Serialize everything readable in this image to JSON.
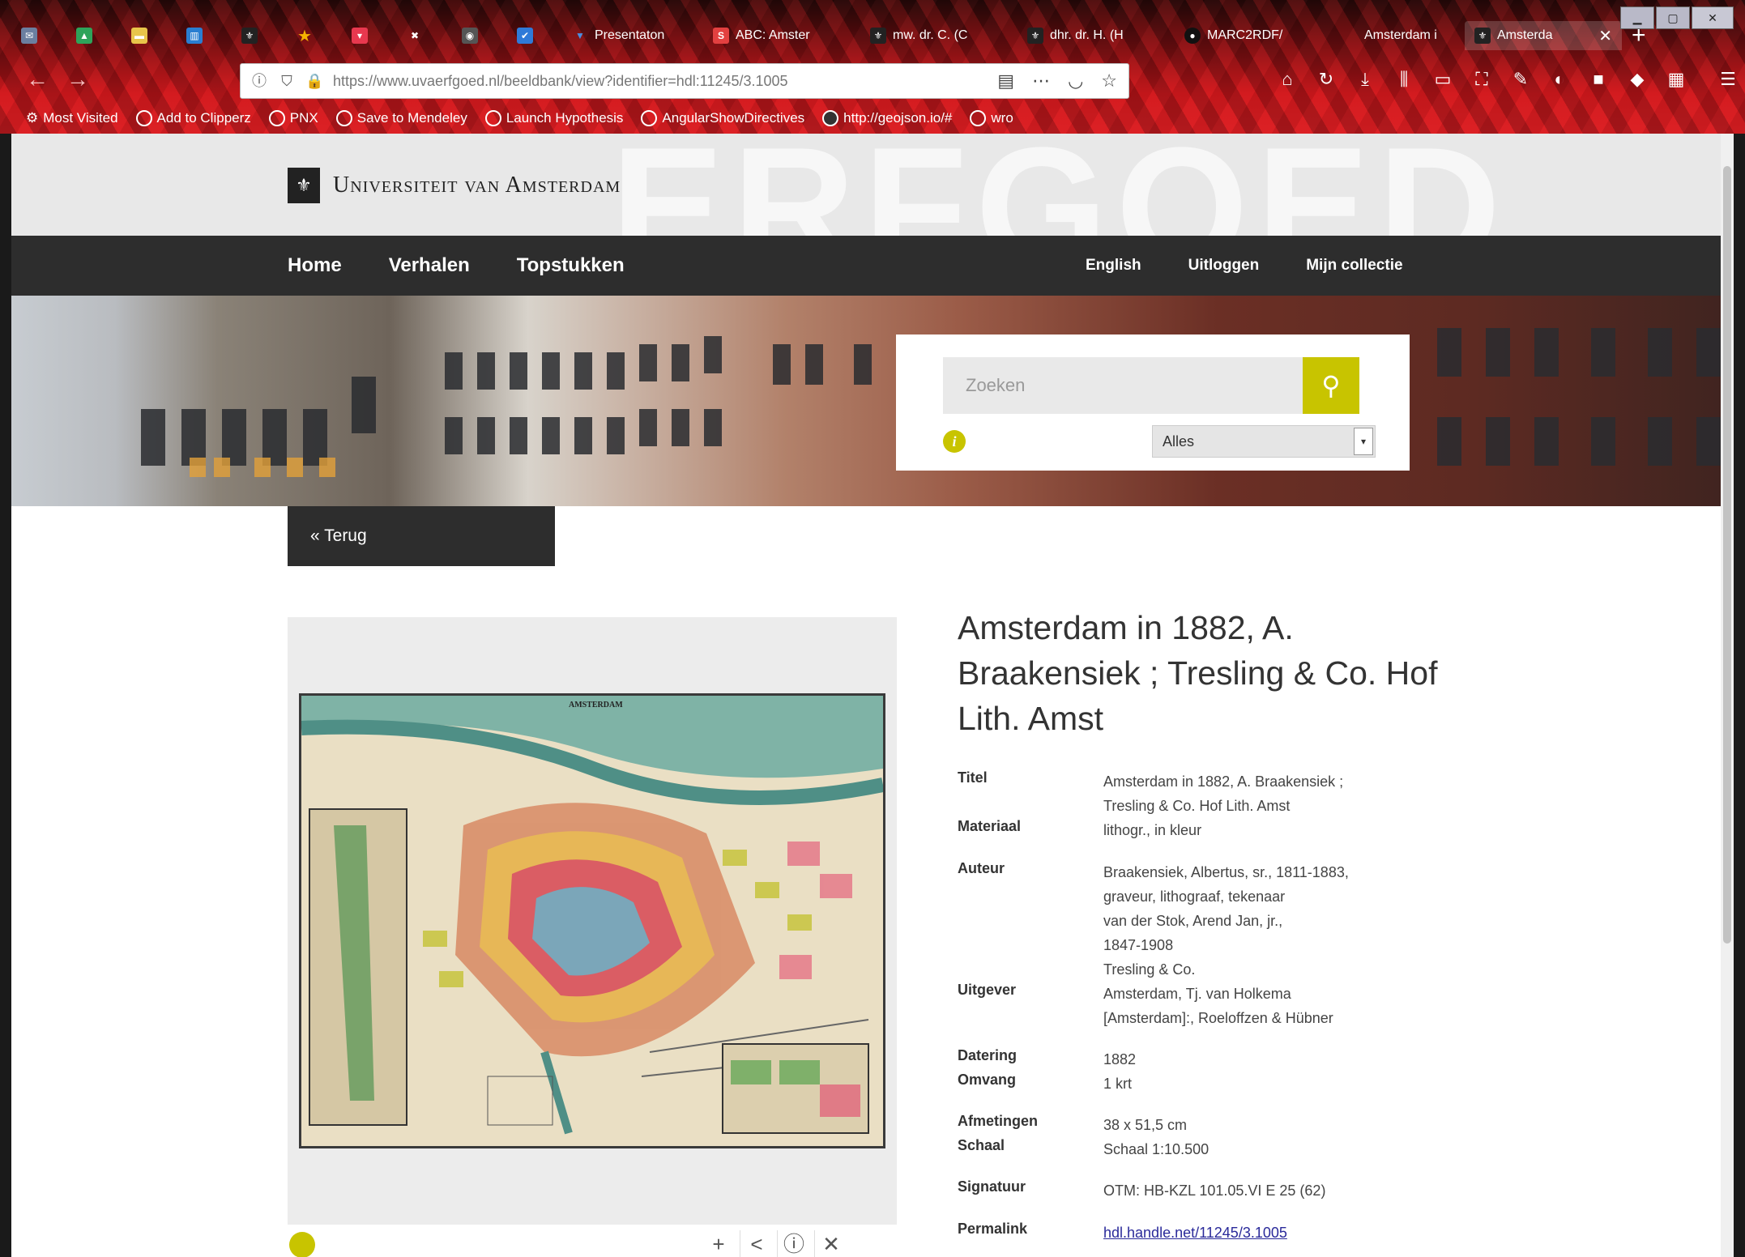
{
  "browser": {
    "tabs": [
      {
        "label": "",
        "icon": "mail-icon"
      },
      {
        "label": "",
        "icon": "drive-icon"
      },
      {
        "label": "",
        "icon": "folder-icon"
      },
      {
        "label": "",
        "icon": "trello-icon"
      },
      {
        "label": "",
        "icon": "uva-icon"
      },
      {
        "label": "",
        "icon": "star-icon"
      },
      {
        "label": "",
        "icon": "pocket-icon"
      },
      {
        "label": "",
        "icon": "pin-icon"
      },
      {
        "label": "",
        "icon": "app-icon"
      },
      {
        "label": "",
        "icon": "check-icon"
      },
      {
        "label": "Presentaton",
        "icon": "triangle-icon"
      },
      {
        "label": "ABC: Amster",
        "icon": "s-icon"
      },
      {
        "label": "mw. dr. C. (C",
        "icon": "uva-icon"
      },
      {
        "label": "dhr. dr. H. (H",
        "icon": "uva-icon"
      },
      {
        "label": "MARC2RDF/",
        "icon": "github-icon"
      },
      {
        "label": "Amsterdam i",
        "icon": "blank-icon"
      },
      {
        "label": "Amsterda",
        "icon": "uva-icon"
      }
    ],
    "url": "https://www.uvaerfgoed.nl/beeldbank/view?identifier=hdl:11245/3.1005",
    "bookmarks": [
      "Most Visited",
      "Add to Clipperz",
      "PNX",
      "Save to Mendeley",
      "Launch Hypothesis",
      "AngularShowDirectives",
      "http://geojson.io/#",
      "wro"
    ]
  },
  "site": {
    "header_watermark": "ERFGOED",
    "logo_text": "Universiteit van Amsterdam",
    "nav_left": [
      "Home",
      "Verhalen",
      "Topstukken"
    ],
    "nav_right": [
      "English",
      "Uitloggen",
      "Mijn collectie"
    ],
    "search_placeholder": "Zoeken",
    "search_scope": "Alles",
    "back_label": "« Terug"
  },
  "record": {
    "title": "Amsterdam in 1882, A. Braakensiek ; Tresling & Co. Hof Lith. Amst",
    "map_caption": "AMSTERDAM",
    "fields": [
      {
        "key": "Titel",
        "lines": [
          "Amsterdam in 1882, A. Braakensiek ;",
          "Tresling & Co. Hof Lith. Amst"
        ]
      },
      {
        "key": "Materiaal",
        "lines": [
          "lithogr., in kleur"
        ]
      },
      {
        "key": "Auteur",
        "lines": [
          "Braakensiek, Albertus, sr., 1811-1883,",
          "graveur, lithograaf, tekenaar",
          "van der Stok, Arend Jan, jr.,",
          "1847-1908",
          "Tresling & Co."
        ]
      },
      {
        "key": "Uitgever",
        "lines": [
          "Amsterdam, Tj. van Holkema",
          "[Amsterdam]:, Roeloffzen & Hübner"
        ]
      },
      {
        "key": "Datering",
        "lines": [
          "1882"
        ]
      },
      {
        "key": "Omvang",
        "lines": [
          "1 krt"
        ]
      },
      {
        "key": "Afmetingen",
        "lines": [
          "38 x 51,5 cm"
        ]
      },
      {
        "key": "Schaal",
        "lines": [
          "Schaal 1:10.500"
        ]
      },
      {
        "key": "Signatuur",
        "lines": [
          "OTM: HB-KZL 101.05.VI E 25 (62)"
        ]
      },
      {
        "key": "Permalink",
        "lines": [
          "hdl.handle.net/11245/3.1005"
        ]
      }
    ]
  }
}
